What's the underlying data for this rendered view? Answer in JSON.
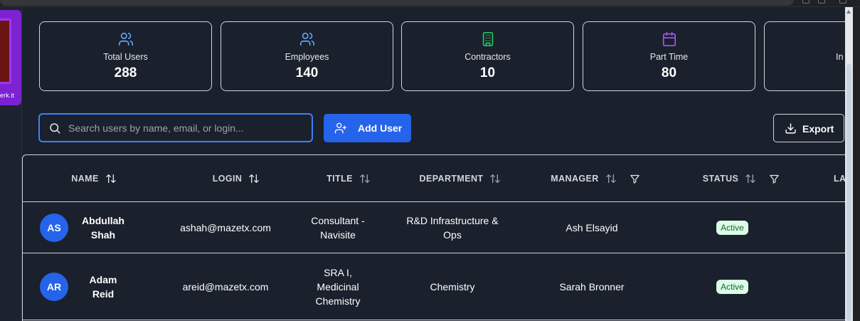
{
  "sidebar": {
    "brand_text": "erk.it"
  },
  "stats": [
    {
      "label": "Total Users",
      "value": "288",
      "icon": "users-icon",
      "color": "#60a5fa"
    },
    {
      "label": "Employees",
      "value": "140",
      "icon": "users-icon",
      "color": "#60a5fa"
    },
    {
      "label": "Contractors",
      "value": "10",
      "icon": "building-icon",
      "color": "#22c55e"
    },
    {
      "label": "Part Time",
      "value": "80",
      "icon": "calendar-icon",
      "color": "#a855f7"
    },
    {
      "label": "In",
      "value": "",
      "icon": "partial-icon",
      "color": "#f97316"
    }
  ],
  "toolbar": {
    "search_placeholder": "Search users by name, email, or login...",
    "add_label": "Add User",
    "export_label": "Export"
  },
  "table": {
    "columns": [
      "NAME",
      "LOGIN",
      "TITLE",
      "DEPARTMENT",
      "MANAGER",
      "STATUS",
      "LA"
    ],
    "rows": [
      {
        "initials": "AS",
        "name": "Abdullah Shah",
        "login": "ashah@mazetx.com",
        "title": "Consultant - Navisite",
        "department": "R&D Infrastructure & Ops",
        "manager": "Ash Elsayid",
        "status": "Active"
      },
      {
        "initials": "AR",
        "name": "Adam Reid",
        "login": "areid@mazetx.com",
        "title": "SRA I, Medicinal Chemistry",
        "department": "Chemistry",
        "manager": "Sarah Bronner",
        "status": "Active"
      }
    ]
  },
  "colors": {
    "accent": "#2563eb",
    "active_badge_bg": "#dcfce7",
    "active_badge_text": "#166534"
  }
}
